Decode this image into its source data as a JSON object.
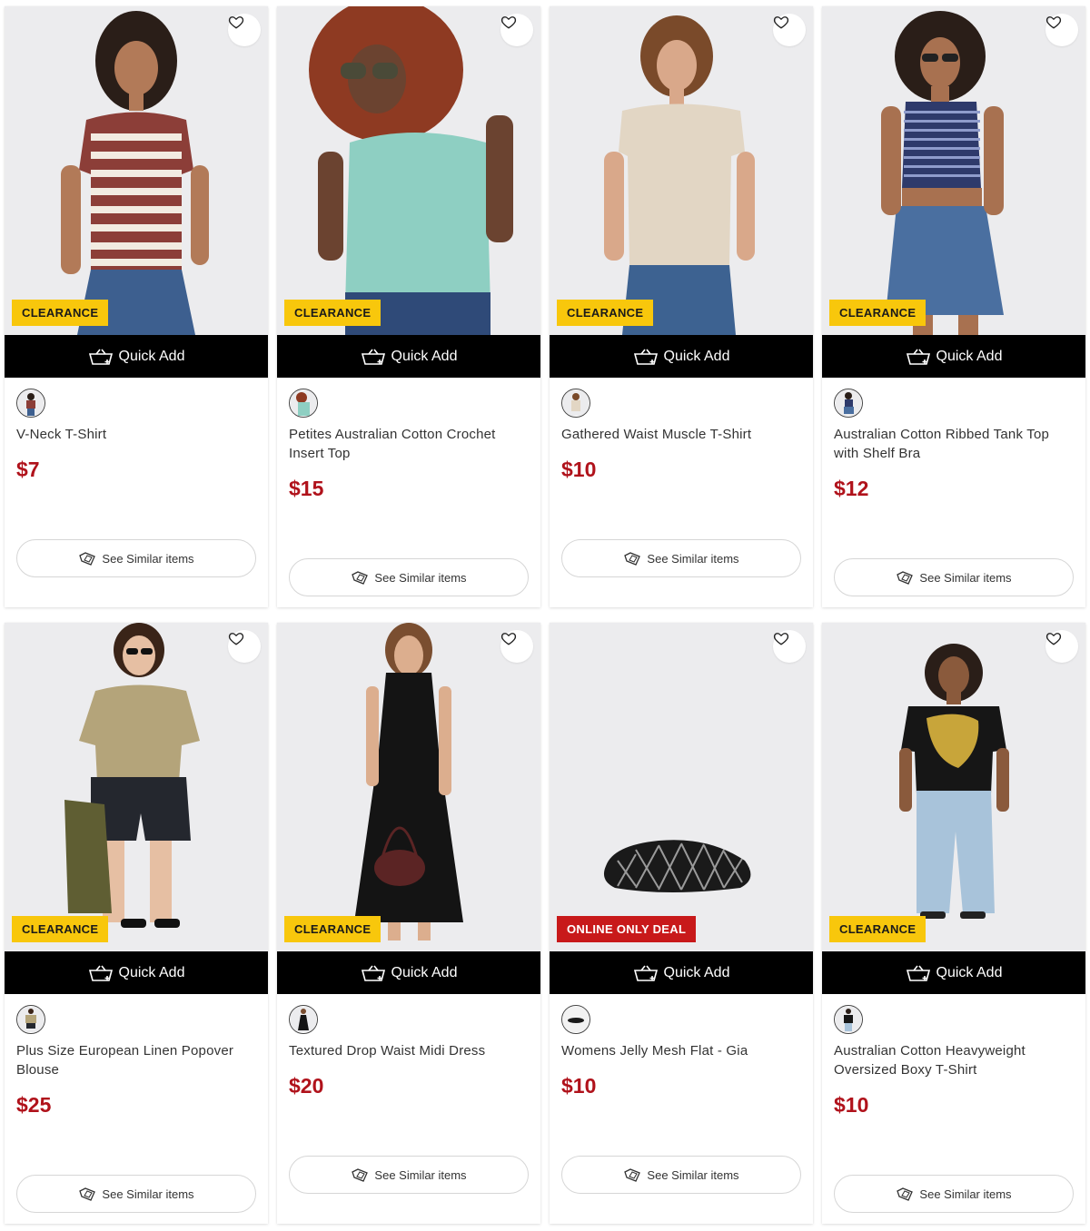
{
  "labels": {
    "quick_add": "Quick Add",
    "see_similar": "See Similar items"
  },
  "colors": {
    "price": "#b0121b",
    "clearance_badge": "#f8c70c",
    "online_badge": "#c8191a"
  },
  "products": [
    {
      "name": "V-Neck T-Shirt",
      "price": "$7",
      "badge": "CLEARANCE",
      "badge_type": "clearance"
    },
    {
      "name": "Petites Australian Cotton Crochet Insert Top",
      "price": "$15",
      "badge": "CLEARANCE",
      "badge_type": "clearance"
    },
    {
      "name": "Gathered Waist Muscle T-Shirt",
      "price": "$10",
      "badge": "CLEARANCE",
      "badge_type": "clearance"
    },
    {
      "name": "Australian Cotton Ribbed Tank Top with Shelf Bra",
      "price": "$12",
      "badge": "CLEARANCE",
      "badge_type": "clearance"
    },
    {
      "name": "Plus Size European Linen Popover Blouse",
      "price": "$25",
      "badge": "CLEARANCE",
      "badge_type": "clearance"
    },
    {
      "name": "Textured Drop Waist Midi Dress",
      "price": "$20",
      "badge": "CLEARANCE",
      "badge_type": "clearance"
    },
    {
      "name": "Womens Jelly Mesh Flat - Gia",
      "price": "$10",
      "badge": "ONLINE ONLY DEAL",
      "badge_type": "online"
    },
    {
      "name": "Australian Cotton Heavyweight Oversized Boxy T-Shirt",
      "price": "$10",
      "badge": "CLEARANCE",
      "badge_type": "clearance"
    }
  ]
}
